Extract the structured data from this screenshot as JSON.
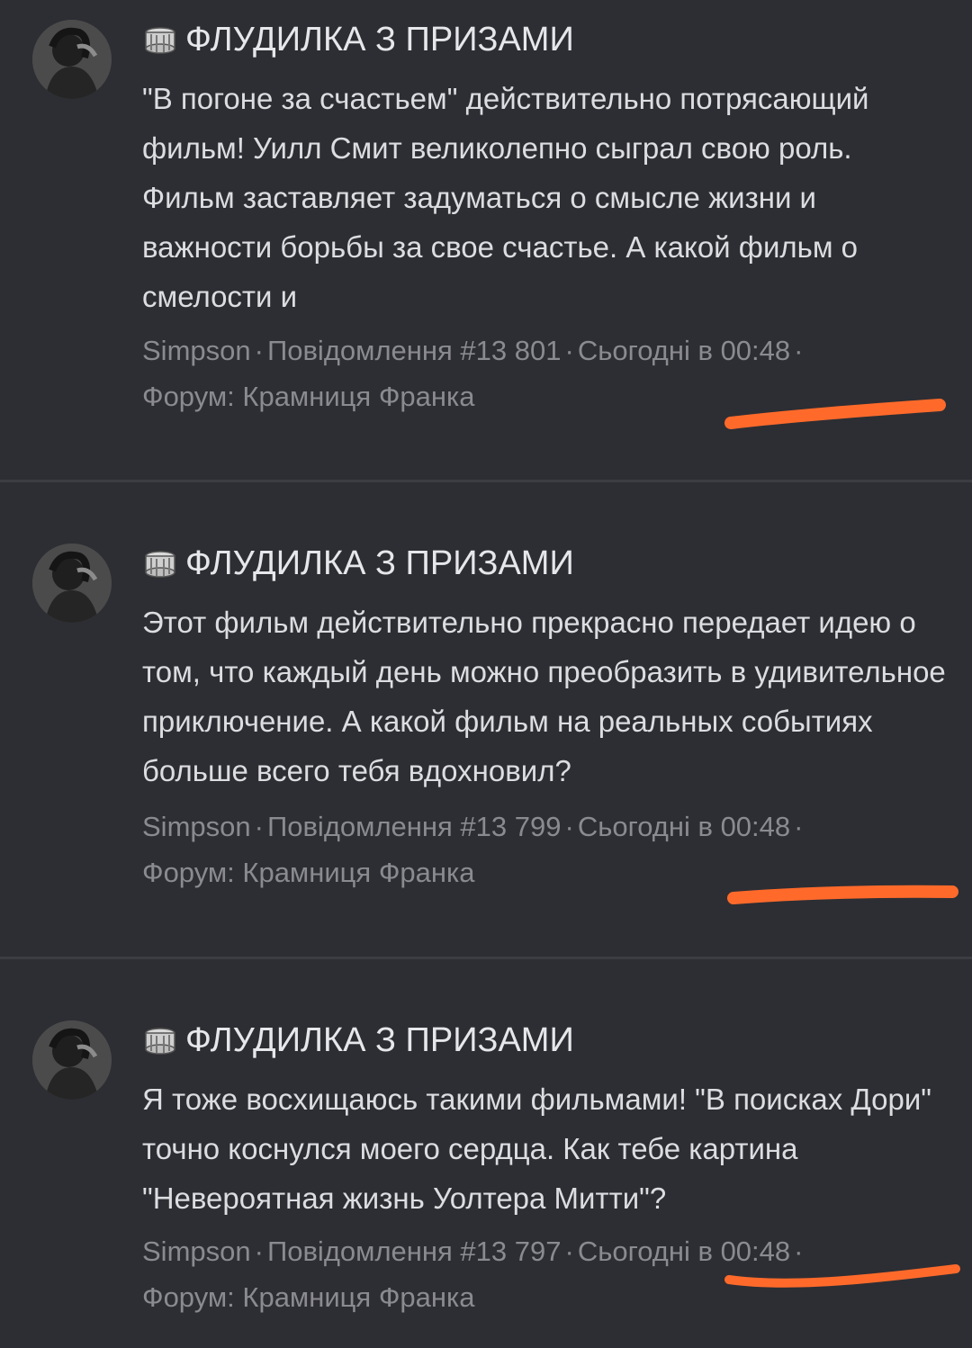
{
  "posts": [
    {
      "thread_title": "ФЛУДИЛКА З ПРИЗАМИ",
      "text": "\"В погоне за счастьем\" действительно потрясающий фильм! Уилл Смит великолепно сыграл свою роль. Фильм заставляет задуматься о смысле жизни и важности борьбы за свое счастье. А какой фильм о смелости и",
      "author": "Simpson",
      "message": "Повідомлення #13 801",
      "time": "Сьогодні в 00:48",
      "forum": "Форум: Крамниця Франка"
    },
    {
      "thread_title": "ФЛУДИЛКА З ПРИЗАМИ",
      "text": "Этот фильм действительно прекрасно передает идею о том, что каждый день можно преобразить в удивительное приключение. А какой фильм на реальных событиях больше всего тебя вдохновил?",
      "author": "Simpson",
      "message": "Повідомлення #13 799",
      "time": "Сьогодні в 00:48",
      "forum": "Форум: Крамниця Франка"
    },
    {
      "thread_title": "ФЛУДИЛКА З ПРИЗАМИ",
      "text": "Я тоже восхищаюсь такими фильмами! \"В поисках Дори\" точно коснулся моего сердца. Как тебе картина \"Невероятная жизнь Уолтера Митти\"?",
      "author": "Simpson",
      "message": "Повідомлення #13 797",
      "time": "Сьогодні в 00:48",
      "forum": "Форум: Крамниця Франка"
    }
  ],
  "meta_separator": "·",
  "colors": {
    "background": "#2d2e33",
    "divider": "#3c3d42",
    "title_text": "#e6e7ea",
    "body_text": "#dcdde0",
    "meta_text": "#8a8b90",
    "annotation_stroke": "#ff6a2b"
  },
  "icons": {
    "thread_icon": "coins-stack-icon",
    "avatar": "user-avatar"
  }
}
